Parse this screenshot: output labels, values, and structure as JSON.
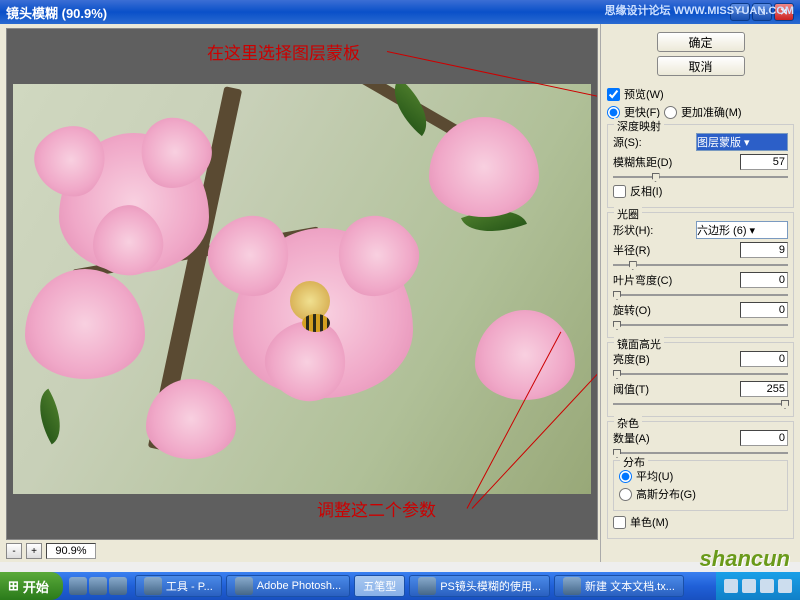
{
  "window": {
    "title": "镜头模糊 (90.9%)",
    "forum": "思缘设计论坛  WWW.MISSYUAN.COM"
  },
  "annotations": {
    "top": "在这里选择图层蒙板",
    "bottom": "调整这二个参数"
  },
  "zoom": {
    "value": "90.9%"
  },
  "buttons": {
    "ok": "确定",
    "cancel": "取消"
  },
  "preview_cb": "预览(W)",
  "speed": {
    "fast": "更快(F)",
    "accurate": "更加准确(M)"
  },
  "depth": {
    "group": "深度映射",
    "source_label": "源(S):",
    "source_value": "图层蒙版",
    "focus_label": "模糊焦距(D)",
    "focus_value": "57",
    "invert": "反相(I)"
  },
  "iris": {
    "group": "光圈",
    "shape_label": "形状(H):",
    "shape_value": "六边形 (6)",
    "radius_label": "半径(R)",
    "radius_value": "9",
    "curv_label": "叶片弯度(C)",
    "curv_value": "0",
    "rot_label": "旋转(O)",
    "rot_value": "0"
  },
  "spec": {
    "group": "镜面高光",
    "bright_label": "亮度(B)",
    "bright_value": "0",
    "thresh_label": "阈值(T)",
    "thresh_value": "255"
  },
  "noise": {
    "group": "杂色",
    "amount_label": "数量(A)",
    "amount_value": "0",
    "dist_group": "分布",
    "uniform": "平均(U)",
    "gaussian": "高斯分布(G)",
    "mono": "单色(M)"
  },
  "taskbar": {
    "start": "开始",
    "ime": "五笔型",
    "tool": "工具 - P...",
    "ps": "Adobe Photosh...",
    "lens": "PS镜头模糊的使用...",
    "note": "新建 文本文档.tx..."
  },
  "watermark": "shancun"
}
